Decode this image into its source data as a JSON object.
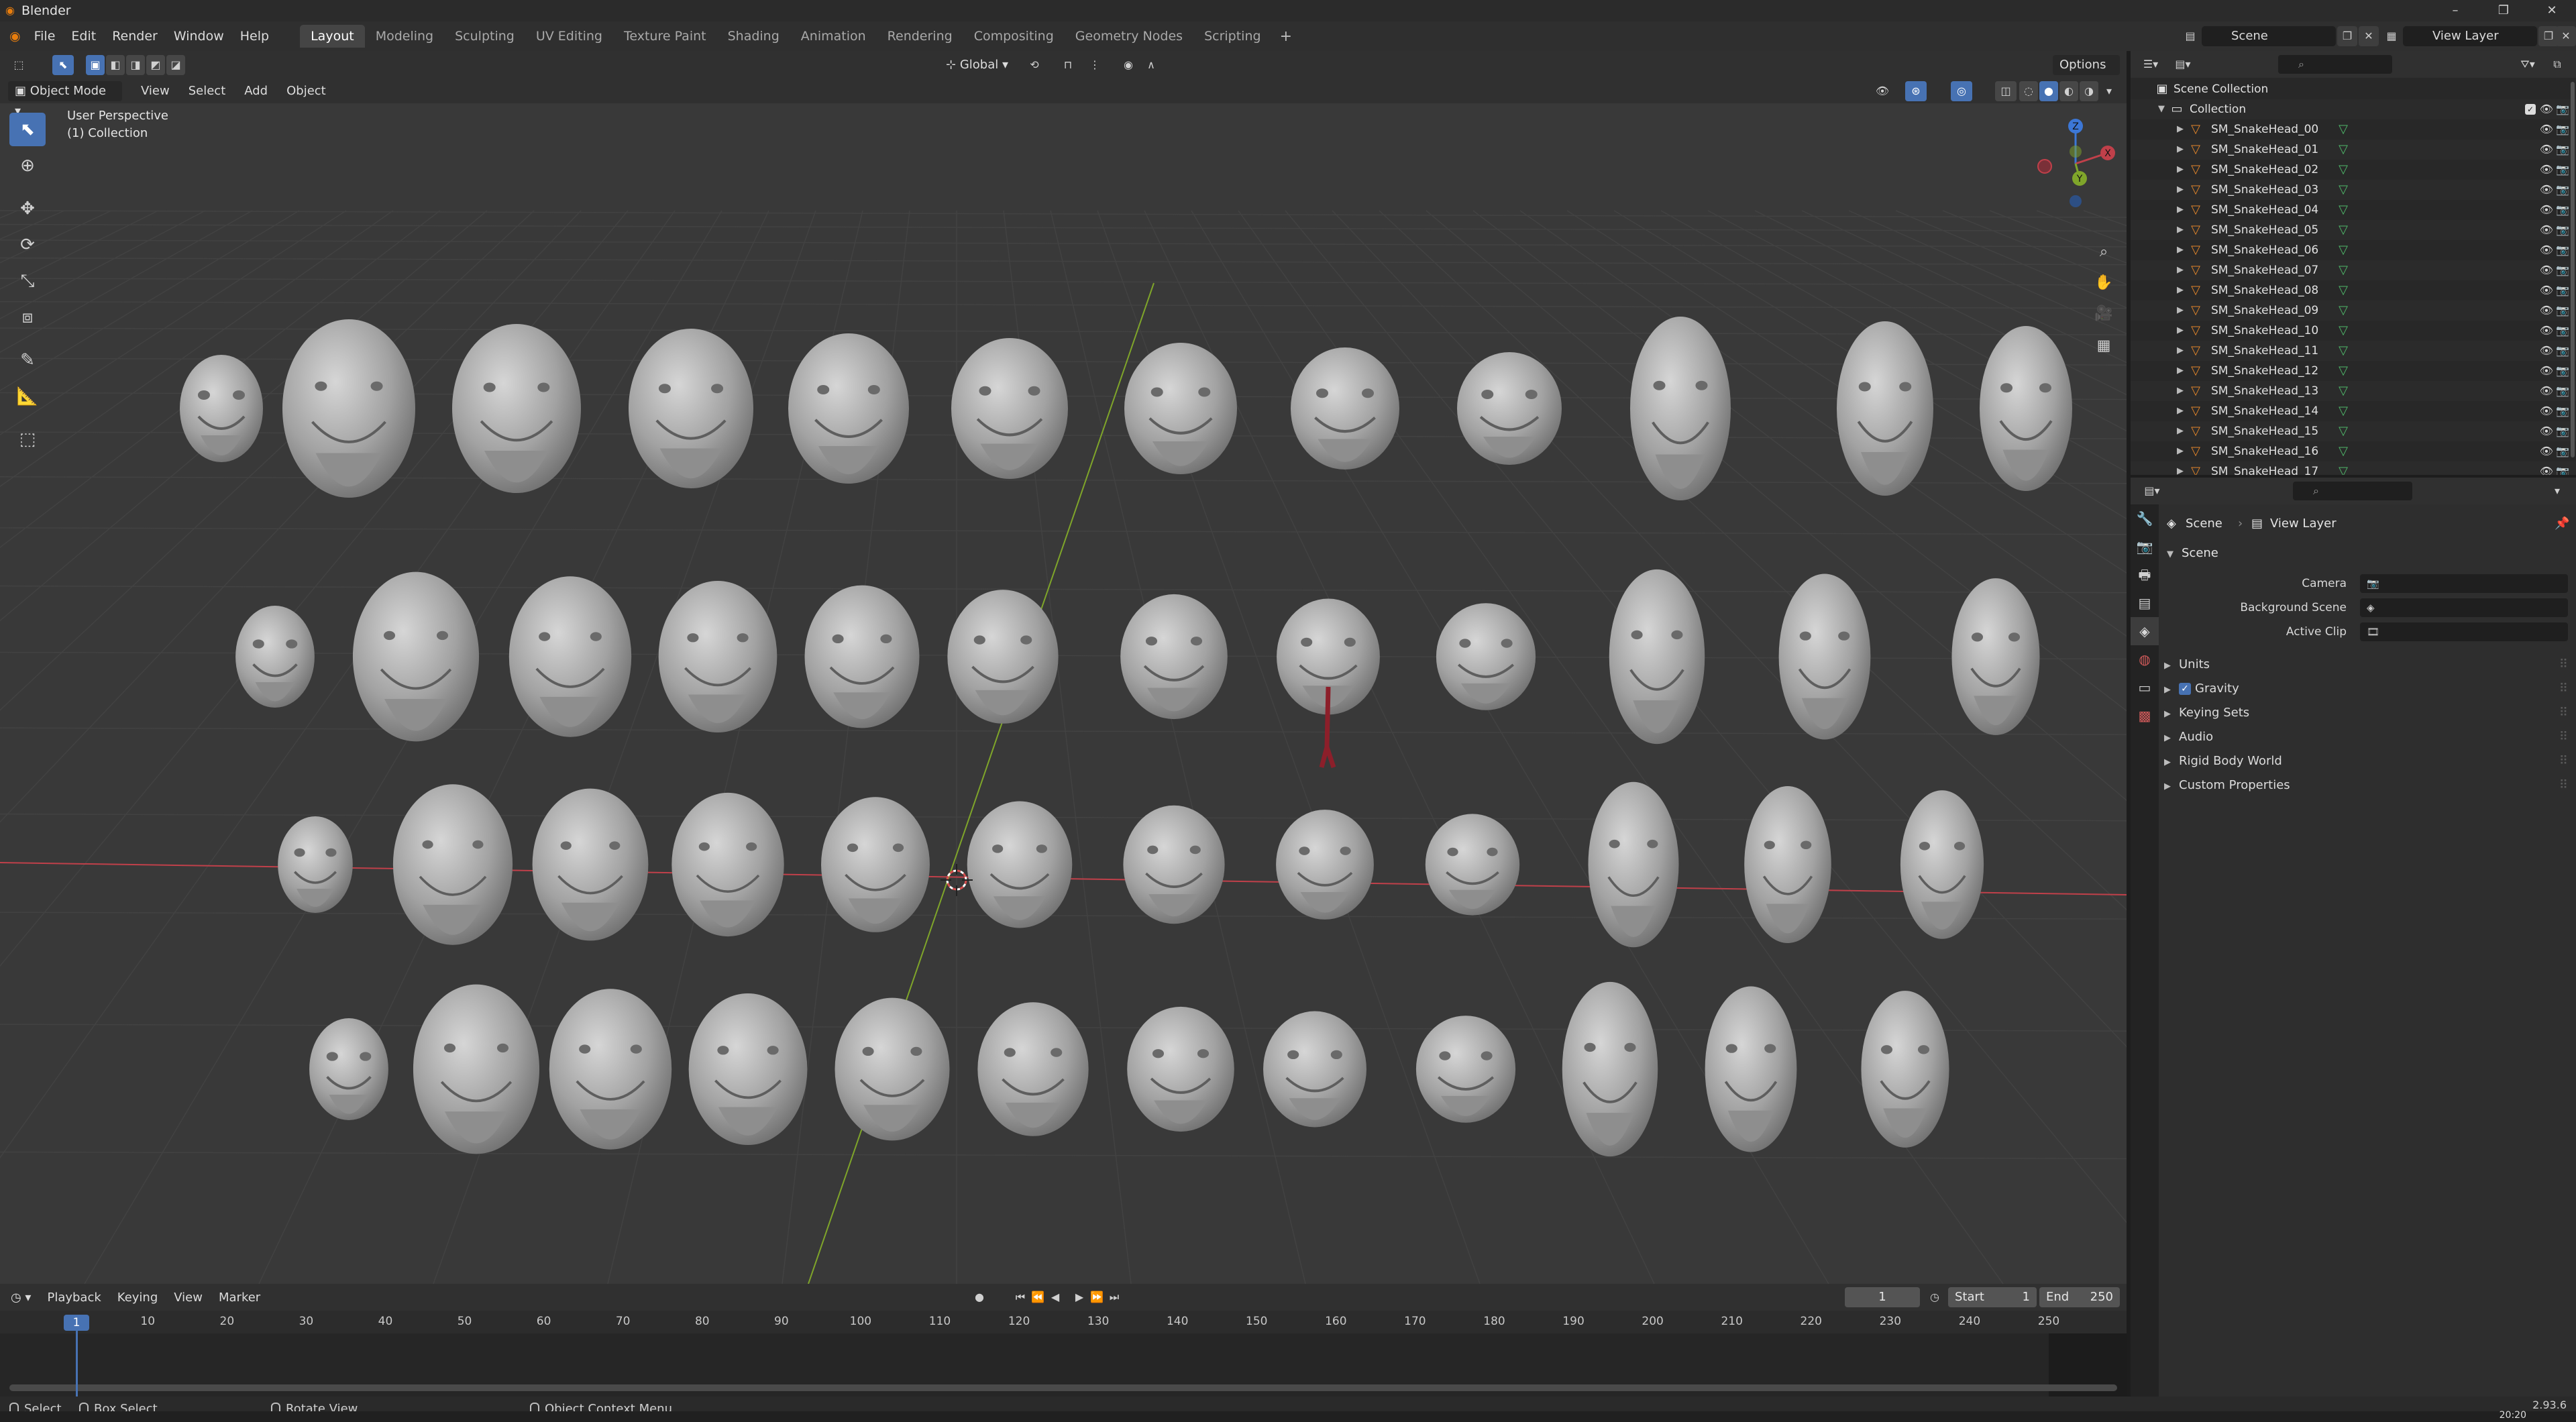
{
  "window": {
    "title": "Blender",
    "controls": [
      "–",
      "❐",
      "✕"
    ]
  },
  "menubar": {
    "items": [
      "File",
      "Edit",
      "Render",
      "Window",
      "Help"
    ],
    "workspaces": [
      "Layout",
      "Modeling",
      "Sculpting",
      "UV Editing",
      "Texture Paint",
      "Shading",
      "Animation",
      "Rendering",
      "Compositing",
      "Geometry Nodes",
      "Scripting"
    ],
    "active_workspace": "Layout",
    "add_tab": "+",
    "scene": "Scene",
    "view_layer": "View Layer"
  },
  "viewport": {
    "mode": "Object Mode",
    "menus": [
      "View",
      "Select",
      "Add",
      "Object"
    ],
    "transform_orientation": "Global",
    "options": "Options",
    "perspective_label": "User Perspective",
    "collection_label": "(1) Collection",
    "gizmo": {
      "x": "X",
      "y": "Y",
      "z": "Z"
    }
  },
  "outliner": {
    "root": "Scene Collection",
    "collection": "Collection",
    "objects": [
      "SM_SnakeHead_00",
      "SM_SnakeHead_01",
      "SM_SnakeHead_02",
      "SM_SnakeHead_03",
      "SM_SnakeHead_04",
      "SM_SnakeHead_05",
      "SM_SnakeHead_06",
      "SM_SnakeHead_07",
      "SM_SnakeHead_08",
      "SM_SnakeHead_09",
      "SM_SnakeHead_10",
      "SM_SnakeHead_11",
      "SM_SnakeHead_12",
      "SM_SnakeHead_13",
      "SM_SnakeHead_14",
      "SM_SnakeHead_15",
      "SM_SnakeHead_16",
      "SM_SnakeHead_17"
    ]
  },
  "properties": {
    "breadcrumb_scene": "Scene",
    "breadcrumb_layer": "View Layer",
    "panel_title": "Scene",
    "camera_label": "Camera",
    "background_label": "Background Scene",
    "active_clip_label": "Active Clip",
    "subpanels": [
      "Units",
      "Gravity",
      "Keying Sets",
      "Audio",
      "Rigid Body World",
      "Custom Properties"
    ],
    "gravity_checked": true
  },
  "timeline": {
    "menus": [
      "Playback",
      "Keying",
      "View",
      "Marker"
    ],
    "current_frame": "1",
    "start_label": "Start",
    "start_value": "1",
    "end_label": "End",
    "end_value": "250",
    "ticks": [
      "1",
      "10",
      "20",
      "30",
      "40",
      "50",
      "60",
      "70",
      "80",
      "90",
      "100",
      "110",
      "120",
      "130",
      "140",
      "150",
      "160",
      "170",
      "180",
      "190",
      "200",
      "210",
      "220",
      "230",
      "240",
      "250"
    ]
  },
  "statusbar": {
    "select": "Select",
    "box_select": "Box Select",
    "rotate_view": "Rotate View",
    "context_menu": "Object Context Menu",
    "version": "2.93.6",
    "clock": "20:20"
  },
  "colors": {
    "accent": "#4772b3",
    "x_axis": "#c0404a",
    "y_axis": "#7fa52a",
    "z_axis": "#3c77d6",
    "mesh_icon": "#e3862b",
    "mesh_data_icon": "#4fb96a"
  }
}
